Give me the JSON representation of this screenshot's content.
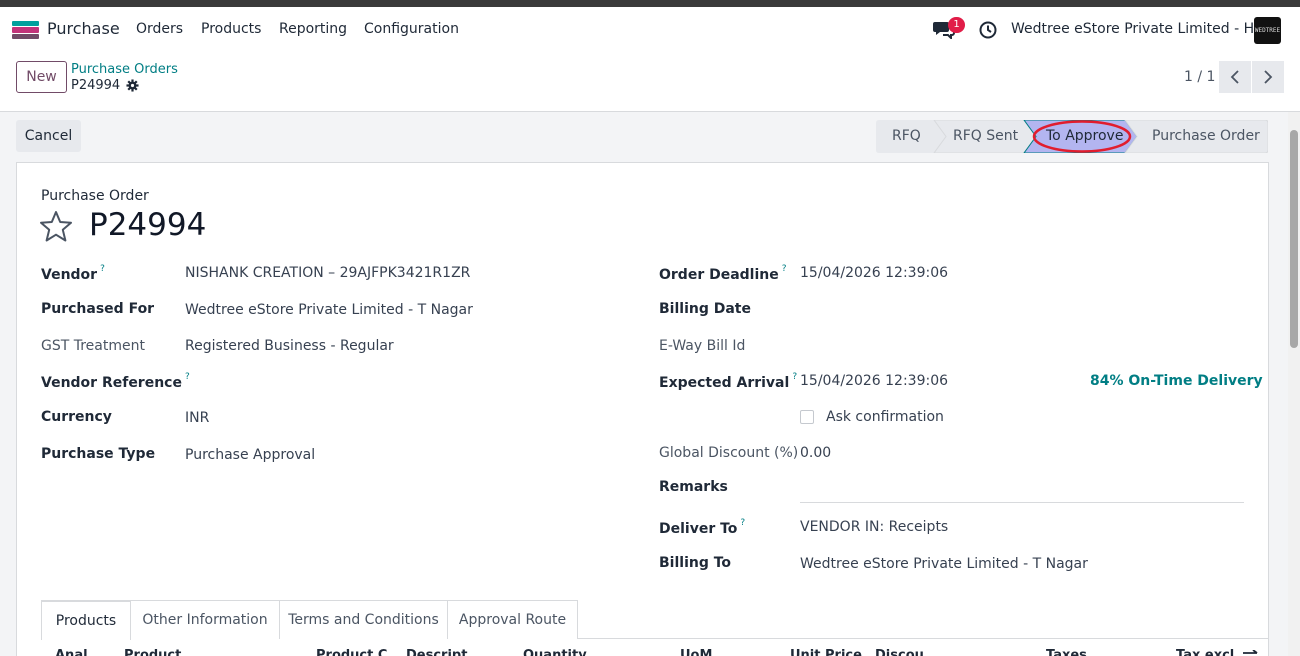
{
  "navbar": {
    "app_name": "Purchase",
    "menu": [
      "Orders",
      "Products",
      "Reporting",
      "Configuration"
    ],
    "chat_count": "1",
    "company": "Wedtree eStore Private Limited - HO",
    "avatar_text": "WEDTREE"
  },
  "control": {
    "new_label": "New",
    "breadcrumb_parent": "Purchase Orders",
    "breadcrumb_current": "P24994",
    "pager": "1 / 1"
  },
  "actions": {
    "cancel_label": "Cancel"
  },
  "statusbar": {
    "stages": [
      "RFQ",
      "RFQ Sent",
      "To Approve",
      "Purchase Order"
    ],
    "active": "To Approve",
    "colors": {
      "active_fill": "#b3b5f0",
      "highlight_ring": "#e11d2e",
      "inactive_fill": "#e7e9ed"
    }
  },
  "form": {
    "doc_type": "Purchase Order",
    "doc_name": "P24994",
    "left": {
      "vendor_label": "Vendor",
      "vendor_value": "NISHANK CREATION – 29AJFPK3421R1ZR",
      "purchased_for_label": "Purchased For",
      "purchased_for_value": "Wedtree eStore Private Limited - T Nagar",
      "gst_label": "GST Treatment",
      "gst_value": "Registered Business - Regular",
      "vendor_ref_label": "Vendor Reference",
      "currency_label": "Currency",
      "currency_value": "INR",
      "purchase_type_label": "Purchase Type",
      "purchase_type_value": "Purchase Approval"
    },
    "right": {
      "order_deadline_label": "Order Deadline",
      "order_deadline_value": "15/04/2026 12:39:06",
      "billing_date_label": "Billing Date",
      "eway_label": "E-Way Bill Id",
      "expected_arrival_label": "Expected Arrival",
      "expected_arrival_value": "15/04/2026 12:39:06",
      "on_time": "84% On-Time Delivery",
      "ask_confirmation": "Ask confirmation",
      "discount_label": "Global Discount (%)",
      "discount_value": "0.00",
      "remarks_label": "Remarks",
      "deliver_to_label": "Deliver To",
      "deliver_to_value": "VENDOR IN: Receipts",
      "billing_to_label": "Billing To",
      "billing_to_value": "Wedtree eStore Private Limited - T Nagar"
    },
    "help_mark": "?"
  },
  "tabs": [
    "Products",
    "Other Information",
    "Terms and Conditions",
    "Approval Route"
  ],
  "table_headers": [
    "Anal",
    "Product",
    "Product C",
    "Descript",
    "Quantity",
    "UoM",
    "Unit Price",
    "Discou",
    "Taxes",
    "Tax excl."
  ]
}
